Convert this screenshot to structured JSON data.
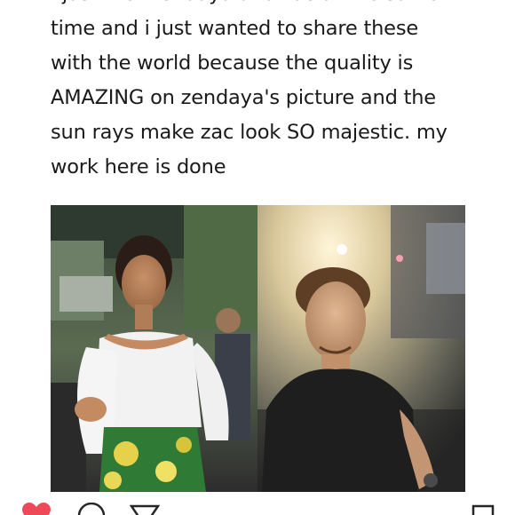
{
  "post": {
    "lines": [
      "i just met zendaya and zac at the same",
      "time and i just wanted to share these",
      "with the world because the quality is",
      "AMAZING on zendaya's picture and the",
      "sun rays make zac look SO majestic. my",
      "work here is done"
    ]
  },
  "photos": {
    "left": {
      "subject": "woman in white off-shoulder blouse and green floral skirt"
    },
    "right": {
      "subject": "man in black shirt in sun-flared light"
    }
  },
  "actions": {
    "like": "heart-icon",
    "comment": "comment-icon",
    "share": "share-icon",
    "save": "bookmark-icon"
  },
  "colors": {
    "text": "#1a1a1a",
    "like_red": "#ed4956"
  }
}
